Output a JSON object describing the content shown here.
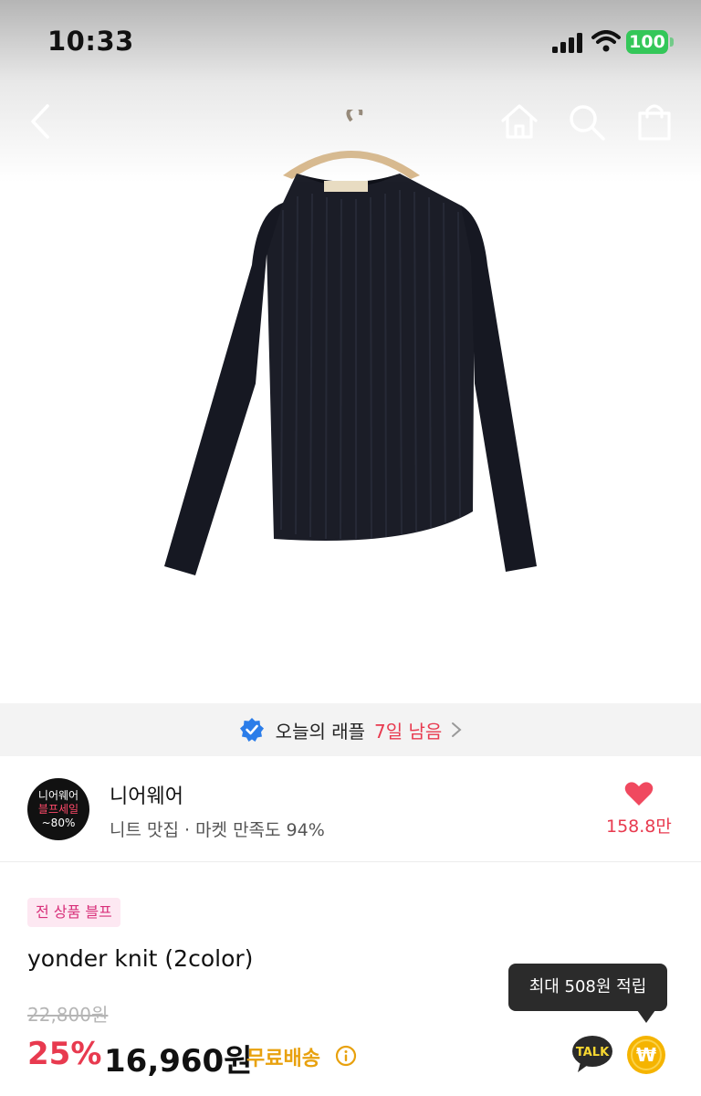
{
  "status_bar": {
    "time": "10:33",
    "battery": "100"
  },
  "nav": {
    "icons": [
      "back-icon",
      "home-icon",
      "search-icon",
      "cart-icon"
    ]
  },
  "raffle": {
    "label": "오늘의 래플",
    "days_left": "7일 남음"
  },
  "store": {
    "logo": {
      "line1": "니어웨어",
      "line2": "블프세일",
      "line3": "~80%"
    },
    "name": "니어웨어",
    "description": "니트 맛집 · 마켓 만족도 94%",
    "likes": "158.8만"
  },
  "product": {
    "badge": "전 상품 블프",
    "title": "yonder knit (2color)",
    "original_price": "22,800원",
    "discount": "25%",
    "price": "16,960원",
    "shipping": "무료배송"
  },
  "tooltip": {
    "text": "최대 508원 적립"
  },
  "colors": {
    "accent": "#e83a4f",
    "shipping": "#e8a10e",
    "battery": "#34c759",
    "point": "#f5b400"
  }
}
